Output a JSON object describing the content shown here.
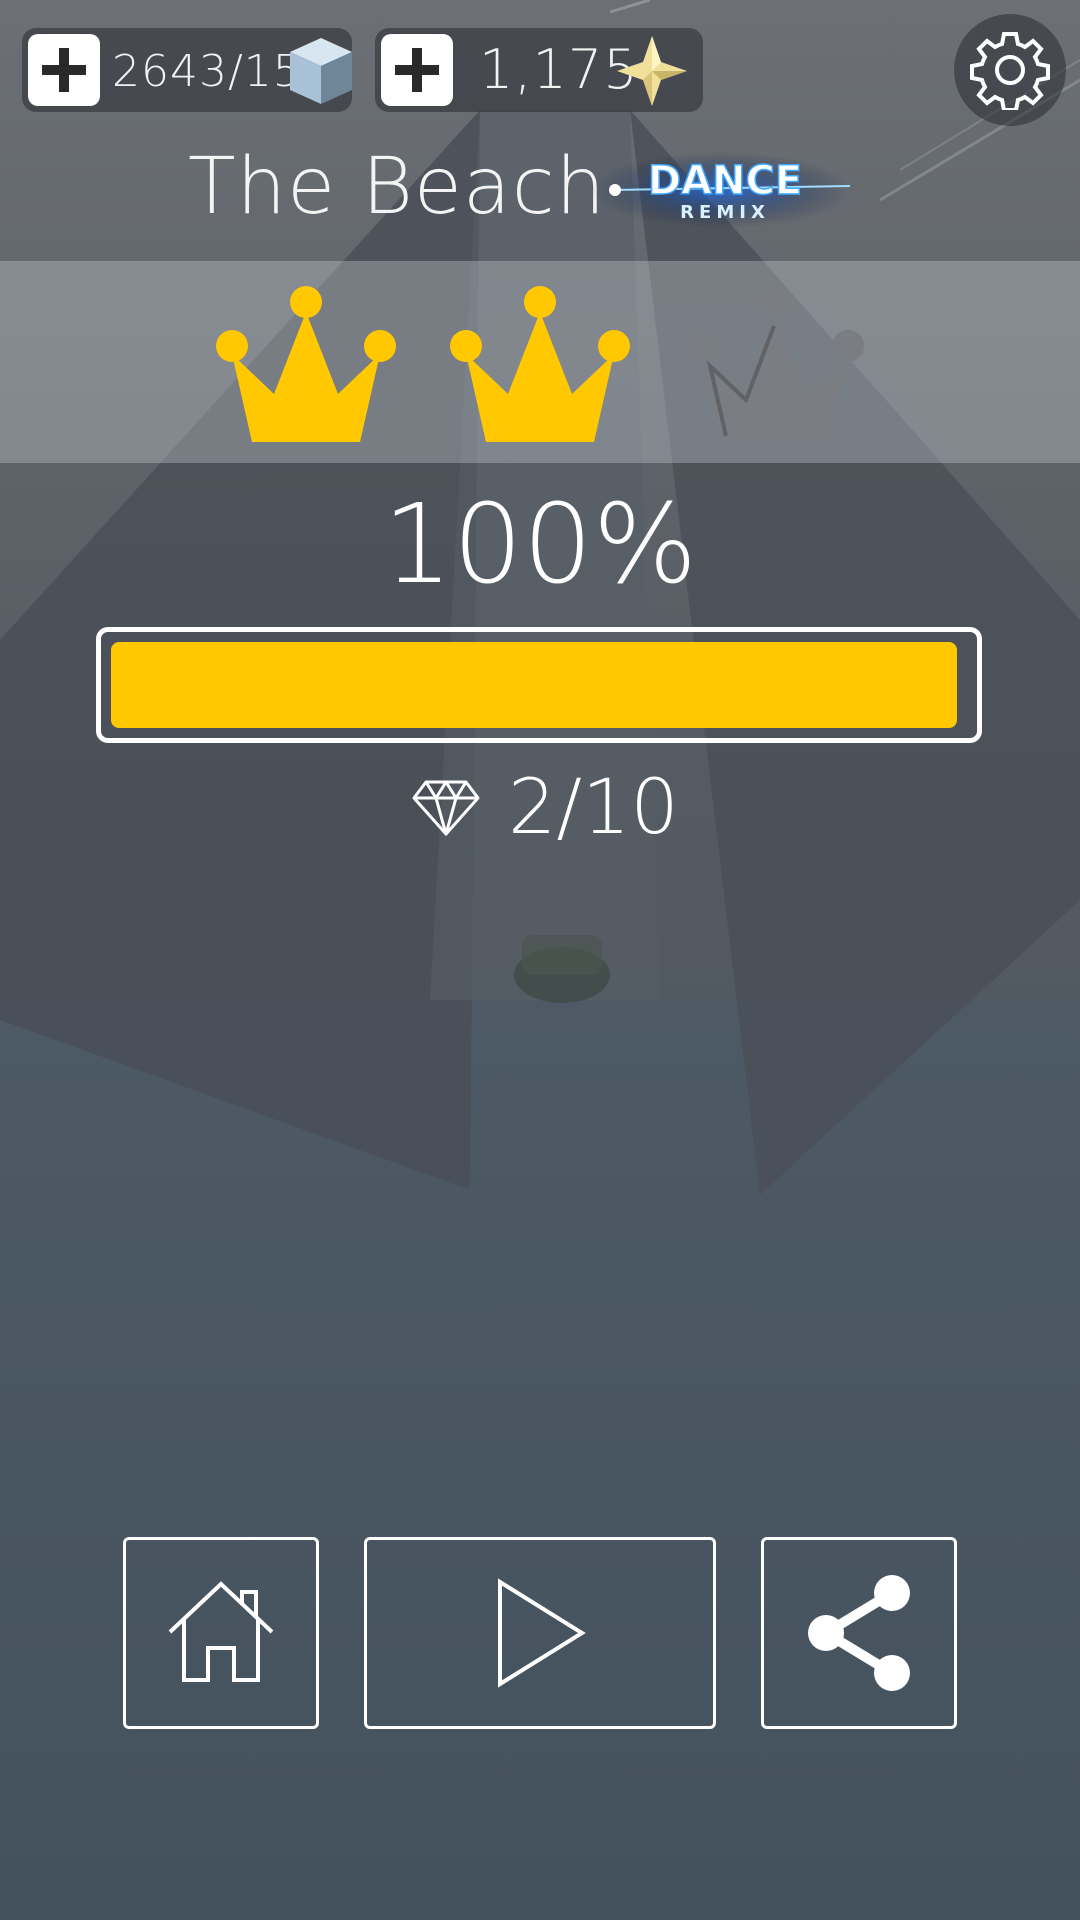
{
  "currency": {
    "cubes": {
      "value": "2643/15",
      "icon": "cube-icon"
    },
    "stars": {
      "value": "1,175",
      "icon": "star-icon"
    }
  },
  "level": {
    "title": "The Beach",
    "badge_line1": "DANCE",
    "badge_line2": "REMIX"
  },
  "crowns": {
    "earned": 2,
    "total": 3,
    "earned_color": "#FFC800",
    "empty_color": "#7A7D82"
  },
  "progress": {
    "percent_label": "100%",
    "fraction": 1.0,
    "fill_color": "#FFC800"
  },
  "gems": {
    "collected": "2/10",
    "icon": "diamond-icon"
  },
  "buttons": {
    "home": {
      "icon": "home-icon"
    },
    "play": {
      "icon": "play-icon"
    },
    "share": {
      "icon": "share-icon"
    },
    "settings": {
      "icon": "gear-icon"
    }
  }
}
